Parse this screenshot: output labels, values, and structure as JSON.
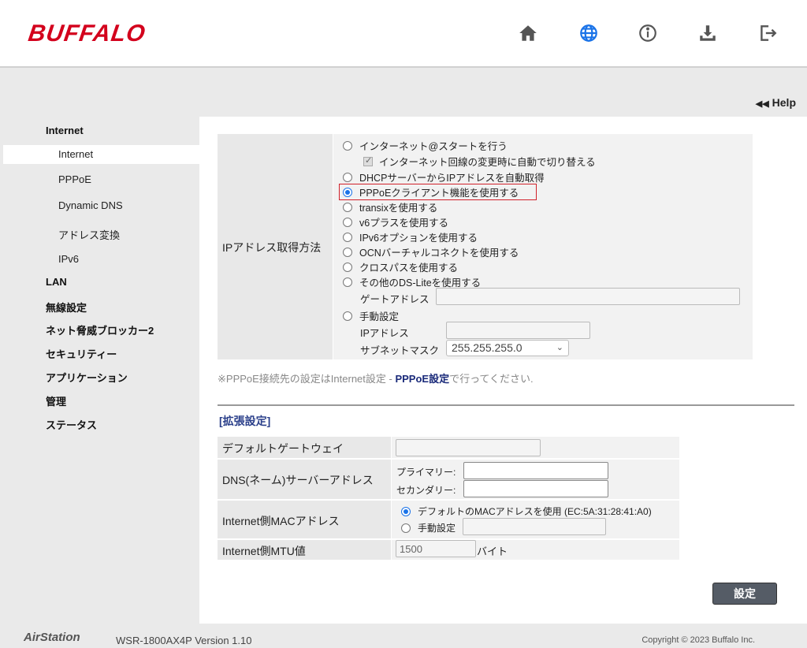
{
  "header": {
    "logo": "BUFFALO",
    "icons": [
      "home-icon",
      "globe-icon",
      "info-icon",
      "download-icon",
      "logout-icon"
    ],
    "accent": "#d3001c"
  },
  "help": {
    "label": "Help"
  },
  "sidebar": {
    "groups": [
      {
        "label": "Internet",
        "items": [
          "Internet",
          "PPPoE",
          "Dynamic DNS",
          "アドレス変換",
          "IPv6"
        ]
      },
      {
        "label": "LAN"
      },
      {
        "label": "無線設定"
      },
      {
        "label": "ネット脅威ブロッカー2"
      },
      {
        "label": "セキュリティー"
      },
      {
        "label": "アプリケーション"
      },
      {
        "label": "管理"
      },
      {
        "label": "ステータス"
      }
    ],
    "active_item": "Internet"
  },
  "method": {
    "label": "IPアドレス取得方法",
    "options": [
      "インターネット@スタートを行う",
      "インターネット回線の変更時に自動で切り替える",
      "DHCPサーバーからIPアドレスを自動取得",
      "PPPoEクライアント機能を使用する",
      "transixを使用する",
      "v6プラスを使用する",
      "IPv6オプションを使用する",
      "OCNバーチャルコネクトを使用する",
      "クロスパスを使用する",
      "その他のDS-Liteを使用する",
      "手動設定"
    ],
    "selected": "PPPoEクライアント機能を使用する",
    "gateway_label": "ゲートアドレス",
    "gateway_value": "",
    "ip_label": "IPアドレス",
    "ip_value": "",
    "subnet_label": "サブネットマスク",
    "subnet_value": "255.255.255.0"
  },
  "note": {
    "prefix": "※PPPoE接続先の設定はInternet設定 - ",
    "link": "PPPoE設定",
    "suffix": "で行ってください."
  },
  "extended": {
    "title": "[拡張設定]",
    "default_gateway": {
      "label": "デフォルトゲートウェイ",
      "value": ""
    },
    "dns": {
      "label": "DNS(ネーム)サーバーアドレス",
      "primary_label": "プライマリー:",
      "secondary_label": "セカンダリー:",
      "primary_value": "",
      "secondary_value": ""
    },
    "mac": {
      "label": "Internet側MACアドレス",
      "default_option": "デフォルトのMACアドレスを使用 (EC:5A:31:28:41:A0)",
      "manual_option": "手動設定",
      "manual_value": ""
    },
    "mtu": {
      "label": "Internet側MTU値",
      "value": "1500",
      "unit": "バイト"
    }
  },
  "submit_label": "設定",
  "footer": {
    "brand": "AirStation",
    "model": "WSR-1800AX4P Version 1.10",
    "copyright": "Copyright © 2023 Buffalo Inc."
  }
}
